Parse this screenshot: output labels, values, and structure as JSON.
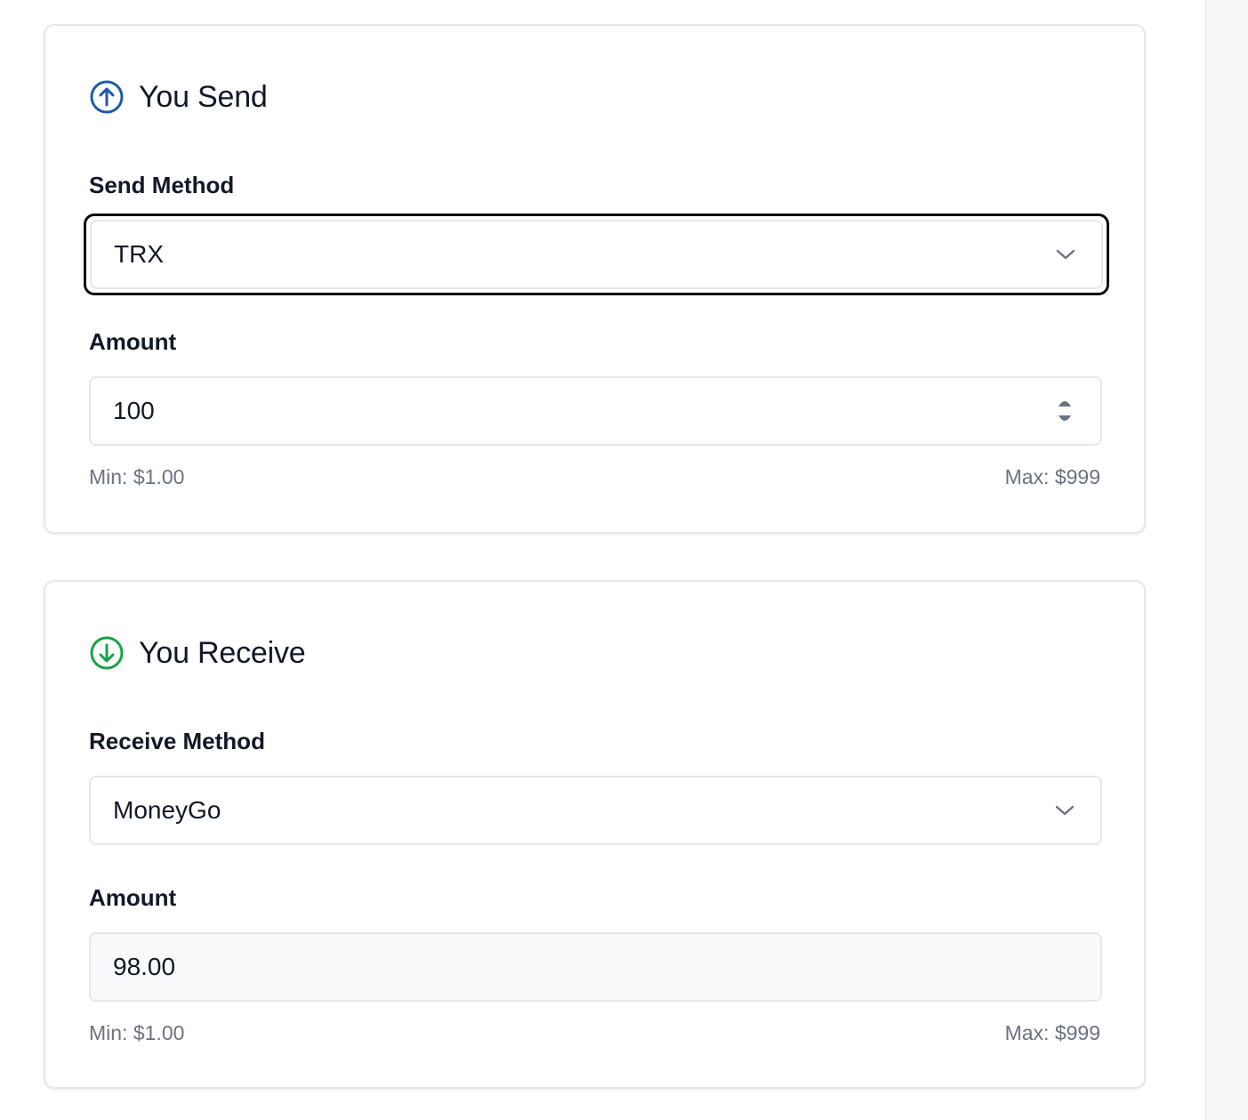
{
  "send": {
    "title": "You Send",
    "icon": "arrow-up-circle-icon",
    "icon_color": "#1e5aa8",
    "method_label": "Send Method",
    "method_value": "TRX",
    "amount_label": "Amount",
    "amount_value": "100",
    "min_text": "Min: $1.00",
    "max_text": "Max: $999"
  },
  "receive": {
    "title": "You Receive",
    "icon": "arrow-down-circle-icon",
    "icon_color": "#16a34a",
    "method_label": "Receive Method",
    "method_value": "MoneyGo",
    "amount_label": "Amount",
    "amount_value": "98.00",
    "min_text": "Min: $1.00",
    "max_text": "Max: $999"
  }
}
